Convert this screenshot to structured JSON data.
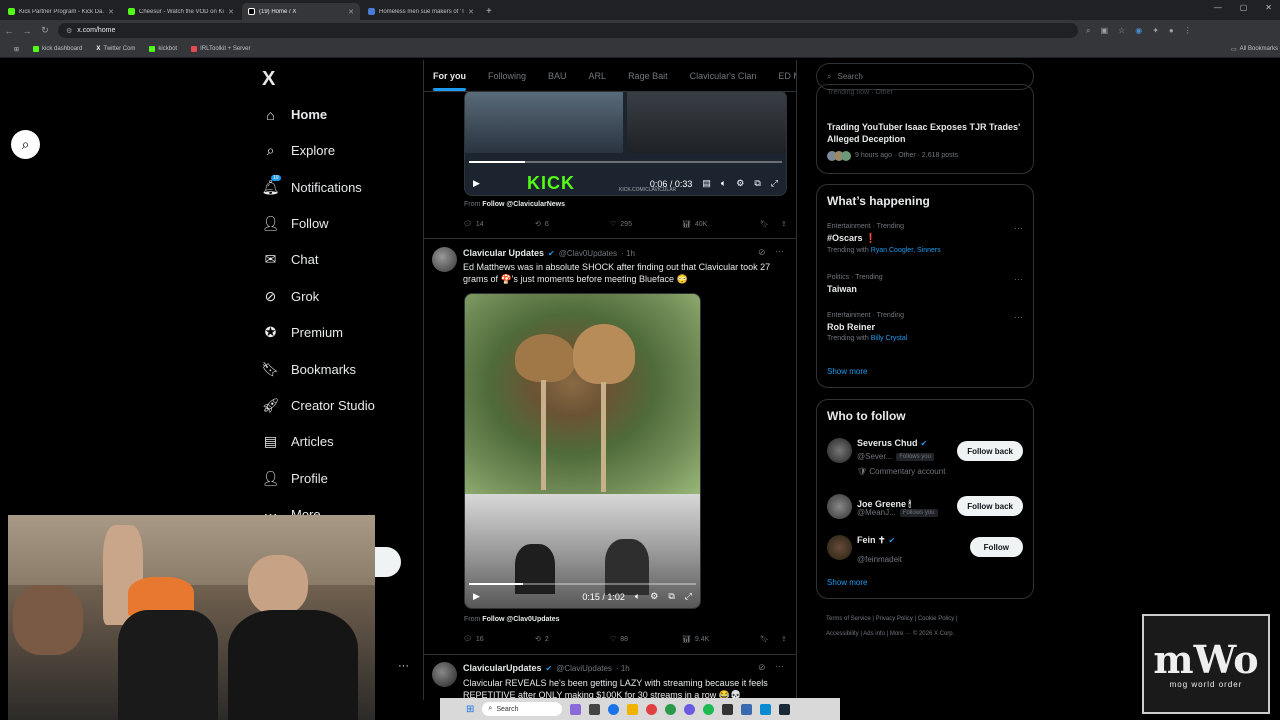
{
  "browser": {
    "tabs": [
      {
        "title": "Kick Partner Program - Kick Da...",
        "color": "#53fc18",
        "active": false
      },
      {
        "title": "Cheesur - Watch the VOD on Ki...",
        "color": "#53fc18",
        "active": false
      },
      {
        "title": "(19) Home / X",
        "color": "#ffffff",
        "active": true
      },
      {
        "title": "Homeless men sue makers of 'T...",
        "color": "#4a7bd4",
        "active": false
      }
    ],
    "url": "x.com/home",
    "bookmarks": [
      "kick dashboard",
      "Twitter Com",
      "kickbot",
      "IRLToolkit + Server"
    ],
    "all_bookmarks": "All Bookmarks"
  },
  "sidebar": {
    "logo": "X",
    "badge": "19",
    "items": [
      {
        "label": "Home",
        "icon": "home-icon"
      },
      {
        "label": "Explore",
        "icon": "search-icon"
      },
      {
        "label": "Notifications",
        "icon": "bell-icon"
      },
      {
        "label": "Follow",
        "icon": "person-add-icon"
      },
      {
        "label": "Chat",
        "icon": "mail-icon"
      },
      {
        "label": "Grok",
        "icon": "grok-icon"
      },
      {
        "label": "Premium",
        "icon": "verified-icon"
      },
      {
        "label": "Bookmarks",
        "icon": "bookmark-icon"
      },
      {
        "label": "Creator Studio",
        "icon": "rocket-icon"
      },
      {
        "label": "Articles",
        "icon": "article-icon"
      },
      {
        "label": "Profile",
        "icon": "person-icon"
      },
      {
        "label": "More",
        "icon": "more-icon"
      }
    ]
  },
  "feed": {
    "tabs": [
      "For you",
      "Following",
      "BAU",
      "ARL",
      "Rage Bait",
      "Clavicular's Clan",
      "ED M"
    ],
    "post0": {
      "time": "0:06 / 0:33",
      "progress": 0.18,
      "watermark": "KICK",
      "watermark_sub": "KICK.COM/CLAVICULAR",
      "from_label": "From",
      "from_name": "Follow @ClavicularNews",
      "replies": "14",
      "reposts": "6",
      "likes": "295",
      "views": "40K"
    },
    "post1": {
      "name": "Clavicular Updates",
      "handle": "@Clav0Updates",
      "age": "· 1h",
      "text": "Ed Matthews was in absolute SHOCK after finding out that Clavicular took 27 grams of 🍄's just moments before meeting Blueface 😳",
      "video_time": "0:15 / 1:02",
      "progress": 0.24,
      "from_label": "From",
      "from_name": "Follow @Clav0Updates",
      "replies": "16",
      "reposts": "2",
      "likes": "88",
      "views": "9.4K"
    },
    "post2": {
      "name": "ClavicularUpdates",
      "handle": "@ClaviUpdates",
      "age": "· 1h",
      "text": "Clavicular REVEALS he's been getting LAZY with streaming because it feels REPETITIVE after ONLY making $100K for 30 streams in a row 😂💀"
    }
  },
  "right": {
    "search_placeholder": "Search",
    "trend_top": {
      "meta_top": "Trending now · Other",
      "title": "Trading YouTuber Isaac Exposes TJR Trades' Alleged Deception",
      "meta": "9 hours ago · Other · 2,618 posts"
    },
    "happening_title": "What’s happening",
    "trends": [
      {
        "category": "Entertainment · Trending",
        "topic": "#Oscars ❗",
        "with_label": "Trending with",
        "with": "Ryan Coogler, Sinners"
      },
      {
        "category": "Politics · Trending",
        "topic": "Taiwan",
        "with_label": "",
        "with": ""
      },
      {
        "category": "Entertainment · Trending",
        "topic": "Rob Reiner",
        "with_label": "Trending with",
        "with": "Billy Crystal"
      }
    ],
    "show_more": "Show more",
    "wtf_title": "Who to follow",
    "follow": [
      {
        "name": "Severus Chud",
        "handle": "@Sever...",
        "follows_you": "Follows you",
        "sub": "Commentary account",
        "button": "Follow back",
        "verified": true
      },
      {
        "name": "Joe Greene 🕯",
        "handle": "@MeanJ...",
        "follows_you": "Follows you",
        "sub": "",
        "button": "Follow back",
        "verified": false
      },
      {
        "name": "Fein ✝",
        "handle": "@feinmadeit",
        "follows_you": "",
        "sub": "",
        "button": "Follow",
        "verified": true
      }
    ],
    "footer": {
      "l1": [
        "Terms of Service",
        "Privacy Policy",
        "Cookie Policy"
      ],
      "l2": [
        "Accessibility",
        "Ads info",
        "More ···",
        "© 2026 X Corp."
      ]
    }
  },
  "overlay": {
    "taskbar_search": "Search",
    "mwo_big": "mWo",
    "mwo_small": "mog world order"
  }
}
